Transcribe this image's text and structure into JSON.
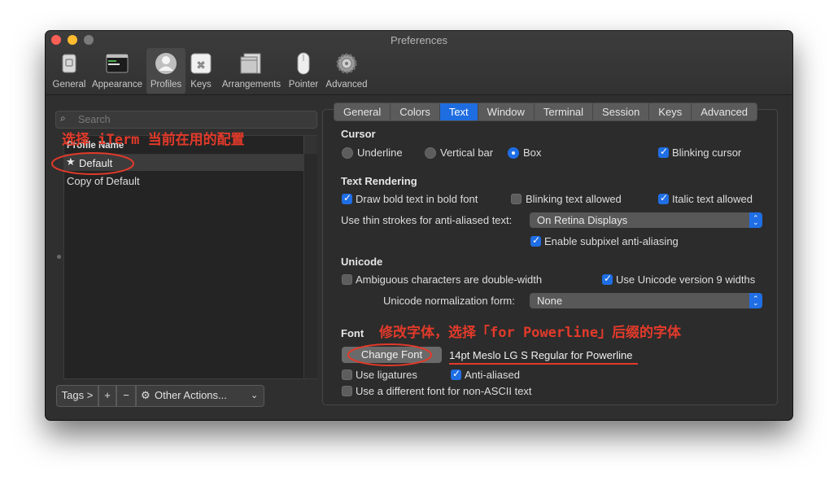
{
  "window": {
    "title": "Preferences"
  },
  "toolbar": {
    "items": [
      {
        "label": "General",
        "icon": "general-icon"
      },
      {
        "label": "Appearance",
        "icon": "appearance-icon"
      },
      {
        "label": "Profiles",
        "icon": "profiles-icon",
        "selected": true
      },
      {
        "label": "Keys",
        "icon": "keys-icon"
      },
      {
        "label": "Arrangements",
        "icon": "arrangements-icon"
      },
      {
        "label": "Pointer",
        "icon": "pointer-icon"
      },
      {
        "label": "Advanced",
        "icon": "gear-icon"
      }
    ]
  },
  "sidebar": {
    "search_placeholder": "Search",
    "column_header": "Profile Name",
    "profiles": [
      {
        "name": "Default",
        "starred": true,
        "selected": true
      },
      {
        "name": "Copy of Default",
        "starred": false
      }
    ],
    "tags_button": "Tags >",
    "add_symbol": "+",
    "remove_symbol": "−",
    "other_actions": "Other Actions..."
  },
  "tabs": {
    "items": [
      "General",
      "Colors",
      "Text",
      "Window",
      "Terminal",
      "Session",
      "Keys",
      "Advanced"
    ],
    "selected": "Text"
  },
  "cursor": {
    "heading": "Cursor",
    "underline": "Underline",
    "vertical_bar": "Vertical bar",
    "box": "Box",
    "selected": "Box",
    "blinking_cursor": "Blinking cursor",
    "blinking_checked": true
  },
  "text_rendering": {
    "heading": "Text Rendering",
    "draw_bold": "Draw bold text in bold font",
    "draw_bold_checked": true,
    "blinking_text": "Blinking text allowed",
    "blinking_text_checked": false,
    "italic_text": "Italic text allowed",
    "italic_text_checked": true,
    "thin_strokes_label": "Use thin strokes for anti-aliased text:",
    "thin_strokes_value": "On Retina Displays",
    "subpixel": "Enable subpixel anti-aliasing",
    "subpixel_checked": true
  },
  "unicode": {
    "heading": "Unicode",
    "ambiguous": "Ambiguous characters are double-width",
    "ambiguous_checked": false,
    "unicode9": "Use Unicode version 9 widths",
    "unicode9_checked": true,
    "normalization_label": "Unicode normalization form:",
    "normalization_value": "None"
  },
  "font": {
    "heading": "Font",
    "change_font_button": "Change Font",
    "current_font": "14pt Meslo LG S Regular for Powerline",
    "ligatures": "Use ligatures",
    "ligatures_checked": false,
    "anti_aliased": "Anti-aliased",
    "anti_aliased_checked": true,
    "non_ascii": "Use a different font for non-ASCII text",
    "non_ascii_checked": false
  },
  "annotations": {
    "select_profile": "选择 iTerm 当前在用的配置",
    "change_font": "修改字体，选择「for Powerline」后缀的字体",
    "color": "#e23a2a"
  },
  "colors": {
    "accent": "#1f6ee5",
    "window_bg": "#2f2f2f",
    "annotation": "#e23a2a"
  }
}
